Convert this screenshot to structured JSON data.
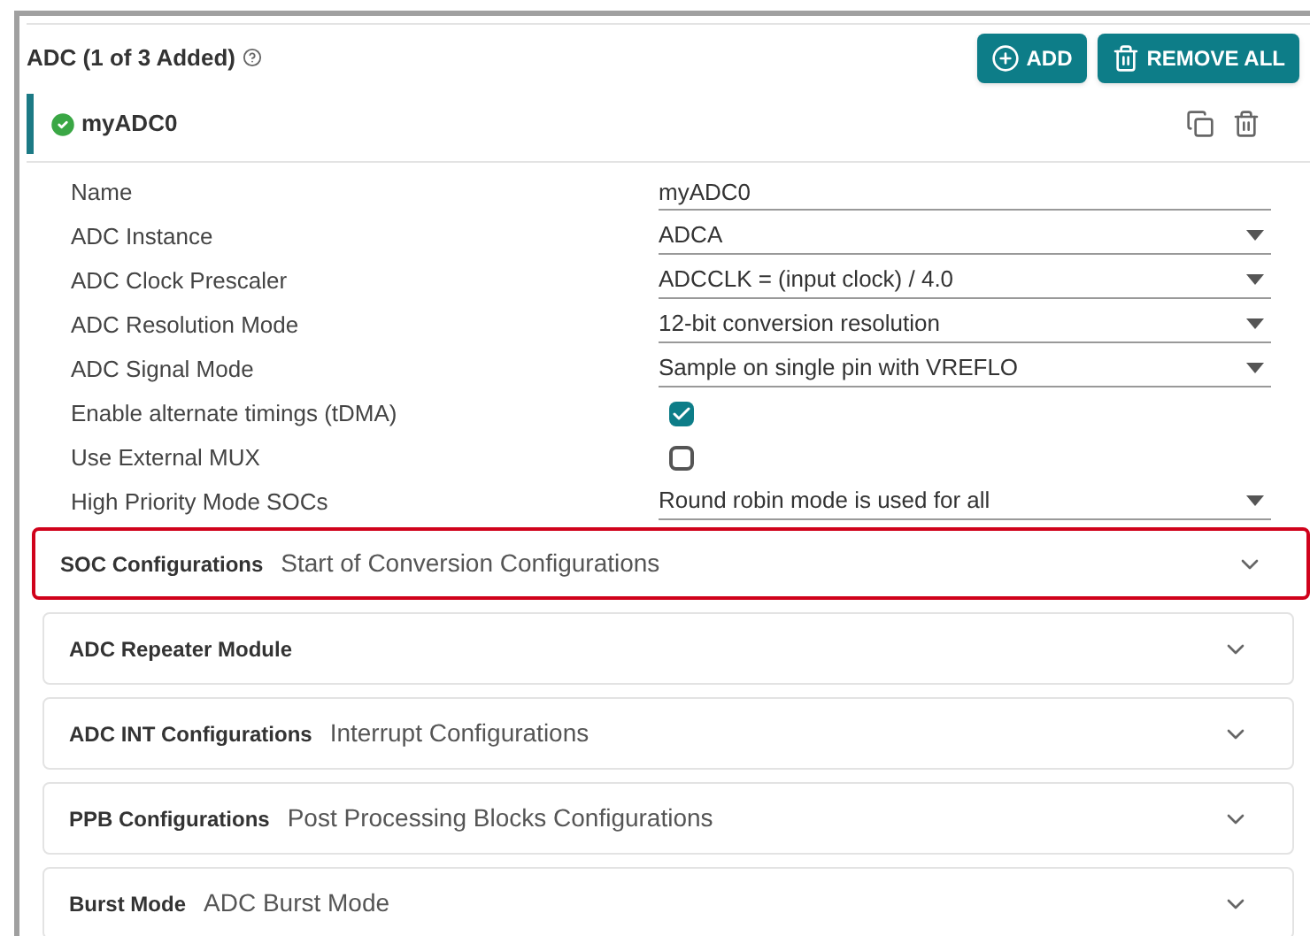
{
  "header": {
    "title": "ADC (1 of 3 Added)",
    "buttons": [
      {
        "kind": "add",
        "label": "ADD"
      },
      {
        "kind": "remove",
        "label": "REMOVE ALL"
      }
    ]
  },
  "instance": {
    "name": "myADC0",
    "valid": true
  },
  "fields": [
    {
      "label": "Name",
      "kind": "text",
      "value": "myADC0"
    },
    {
      "label": "ADC Instance",
      "kind": "select",
      "value": "ADCA"
    },
    {
      "label": "ADC Clock Prescaler",
      "kind": "select",
      "value": "ADCCLK = (input clock) / 4.0"
    },
    {
      "label": "ADC Resolution Mode",
      "kind": "select",
      "value": "12-bit conversion resolution"
    },
    {
      "label": "ADC Signal Mode",
      "kind": "select",
      "value": "Sample on single pin with VREFLO"
    },
    {
      "label": "Enable alternate timings (tDMA)",
      "kind": "checkbox",
      "checked": true
    },
    {
      "label": "Use External MUX",
      "kind": "checkbox",
      "checked": false
    },
    {
      "label": "High Priority Mode SOCs",
      "kind": "select",
      "value": "Round robin mode is used for all"
    }
  ],
  "sections": [
    {
      "title": "SOC Configurations",
      "subtitle": "Start of Conversion Configurations",
      "highlighted": true,
      "expanded": false
    },
    {
      "title": "ADC Repeater Module",
      "highlighted": false,
      "expanded": false
    },
    {
      "title": "ADC INT Configurations",
      "subtitle": "Interrupt Configurations",
      "highlighted": false,
      "expanded": false
    },
    {
      "title": "PPB Configurations",
      "subtitle": "Post Processing Blocks Configurations",
      "highlighted": false,
      "expanded": false
    },
    {
      "title": "Burst Mode",
      "subtitle": "ADC Burst Mode",
      "highlighted": false,
      "expanded": false
    }
  ]
}
